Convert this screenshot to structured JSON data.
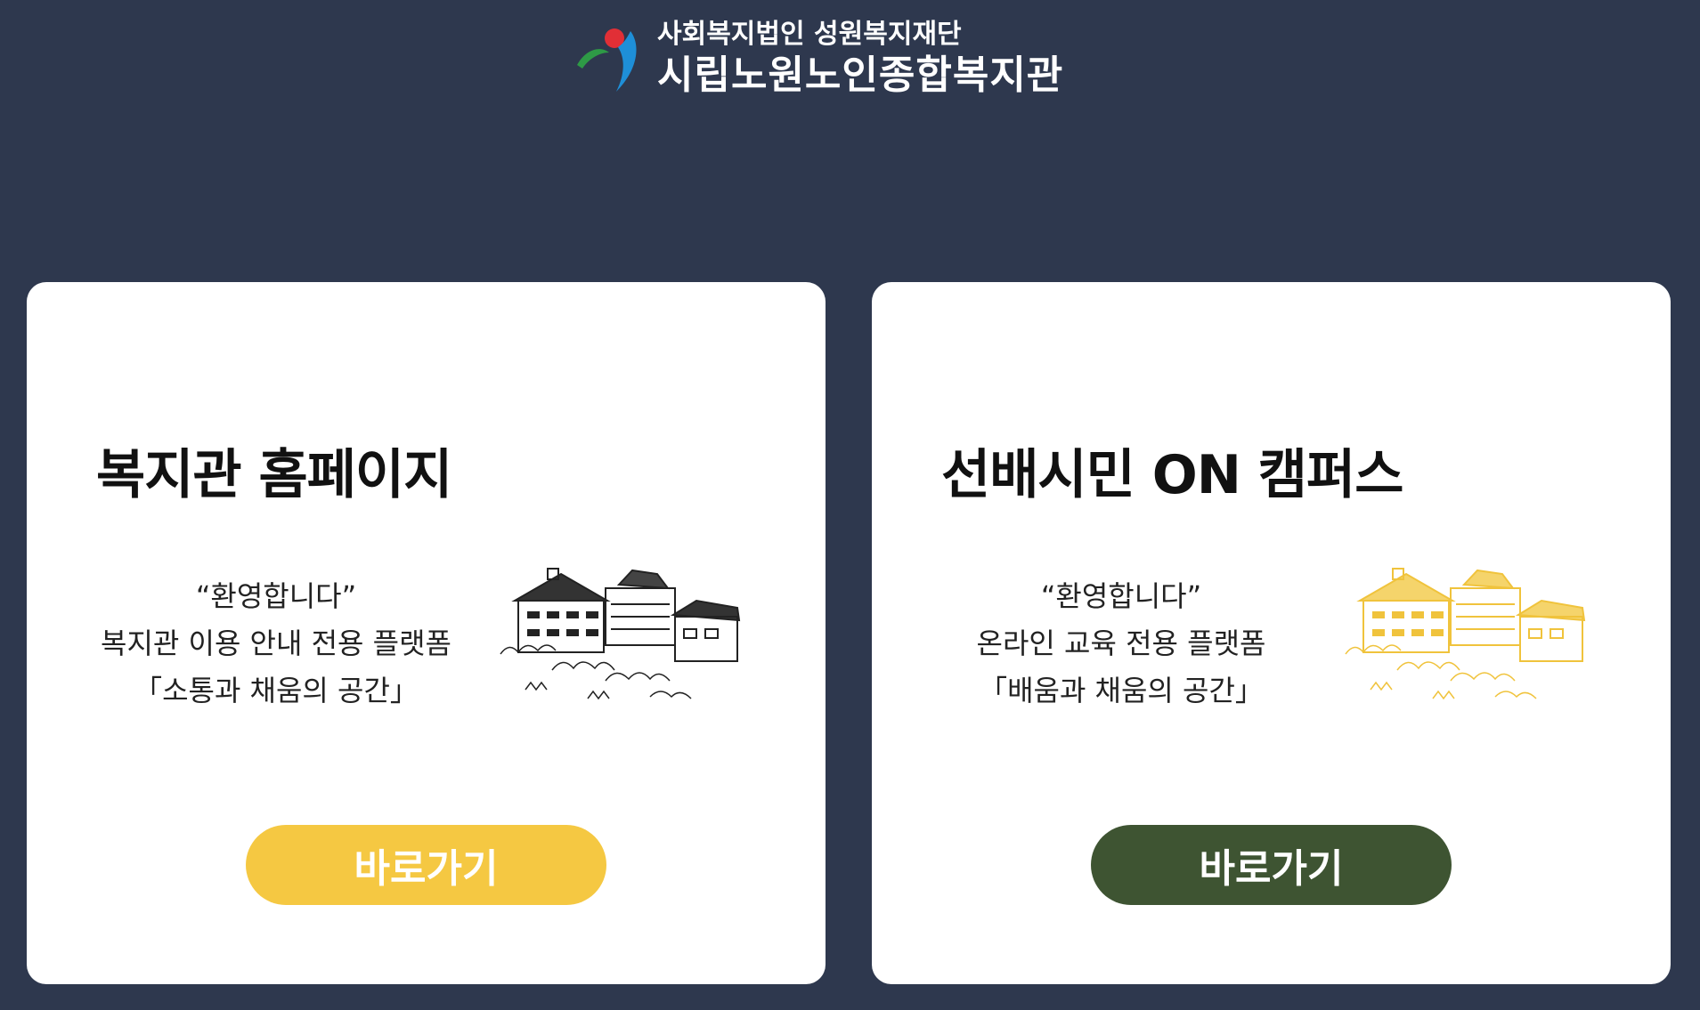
{
  "header": {
    "org_subtitle": "사회복지법인 성원복지재단",
    "org_name": "시립노원노인종합복지관"
  },
  "cards": [
    {
      "title": "복지관 홈페이지",
      "greeting": "“환영합니다”",
      "description": "복지관 이용 안내 전용 플랫폼",
      "slogan": "「소통과 채움의 공간」",
      "button_label": "바로가기",
      "button_color": "#f5c842",
      "illustration_color": "#222222",
      "icon": "building-illustration"
    },
    {
      "title": "선배시민 ON 캠퍼스",
      "greeting": "“환영합니다”",
      "description": "온라인 교육 전용 플랫폼",
      "slogan": "「배움과 채움의 공간」",
      "button_label": "바로가기",
      "button_color": "#3e5432",
      "illustration_color": "#f0c33c",
      "icon": "building-illustration"
    }
  ],
  "colors": {
    "background": "#2e384e",
    "card": "#ffffff"
  }
}
